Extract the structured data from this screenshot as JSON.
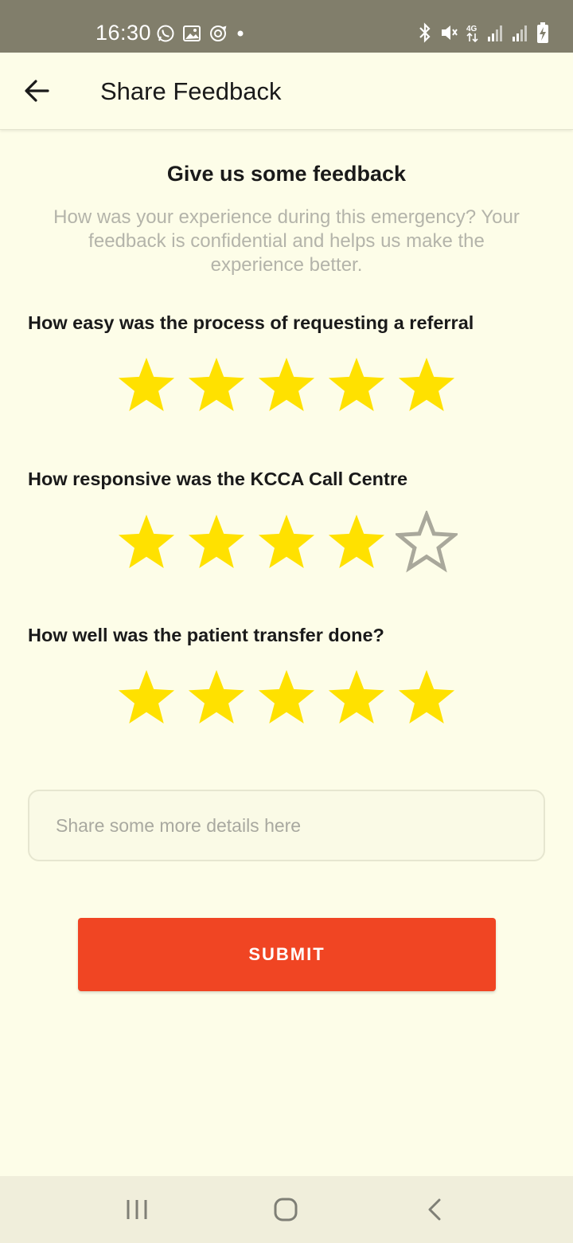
{
  "status_bar": {
    "time": "16:30",
    "left_icons": [
      "whatsapp-icon",
      "gallery-icon",
      "sync-icon",
      "dot-icon"
    ],
    "right_icons": [
      "bluetooth-icon",
      "mute-icon",
      "4g-icon",
      "signal-icon",
      "signal-icon",
      "battery-charging-icon"
    ],
    "network_label": "4G"
  },
  "app_bar": {
    "back_icon": "arrow-left-icon",
    "title": "Share Feedback"
  },
  "content": {
    "heading": "Give us some feedback",
    "subtitle": "How was your experience during this emergency? Your feedback is confidential and helps us make the experience better.",
    "questions": [
      {
        "label": "How easy was the process of requesting a referral",
        "rating": 5,
        "max": 5
      },
      {
        "label": "How responsive was the KCCA Call Centre",
        "rating": 4,
        "max": 5
      },
      {
        "label": "How well was the patient transfer done?",
        "rating": 5,
        "max": 5
      }
    ],
    "details_input": {
      "placeholder": "Share some more details here",
      "value": ""
    },
    "submit_label": "SUBMIT"
  },
  "nav_bar": {
    "icons": [
      "recents-icon",
      "home-icon",
      "back-icon"
    ]
  },
  "colors": {
    "background": "#fdfde8",
    "status_bar": "#817e6b",
    "star_filled": "#ffe100",
    "star_empty_outline": "#a9a89b",
    "accent": "#f04523",
    "subtitle_text": "#b4b4aa"
  }
}
